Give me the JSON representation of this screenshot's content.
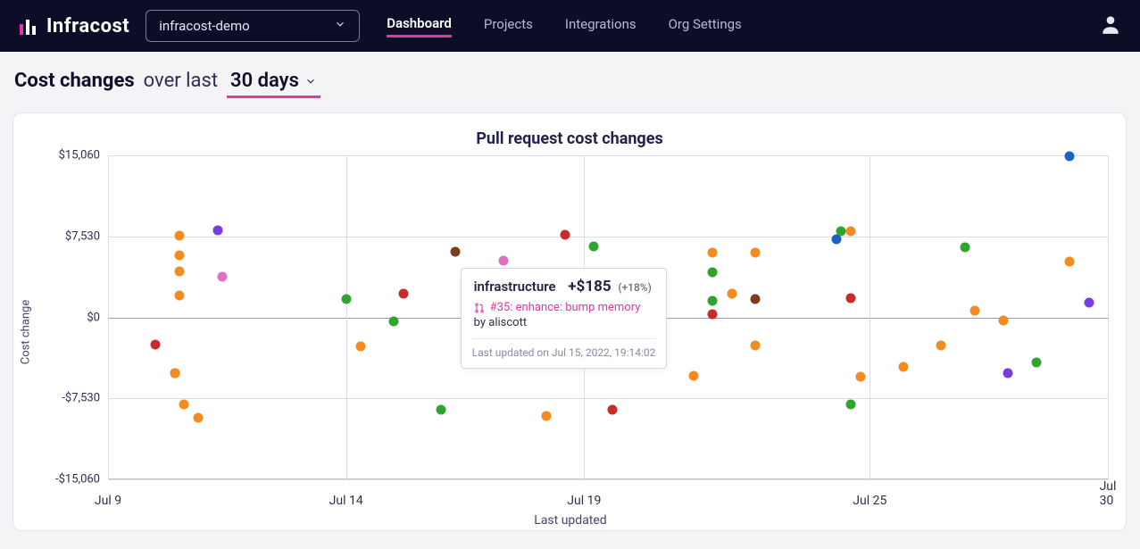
{
  "brand": {
    "name": "Infracost"
  },
  "org_select": {
    "value": "infracost-demo"
  },
  "nav": {
    "items": [
      {
        "label": "Dashboard",
        "active": true
      },
      {
        "label": "Projects",
        "active": false
      },
      {
        "label": "Integrations",
        "active": false
      },
      {
        "label": "Org Settings",
        "active": false
      }
    ]
  },
  "header": {
    "strong": "Cost changes",
    "muted": "over last",
    "range": "30 days"
  },
  "chart_data": {
    "type": "scatter",
    "title": "Pull request cost changes",
    "xlabel": "Last updated",
    "ylabel": "Cost change",
    "ylim": [
      -15060,
      15060
    ],
    "xlim": [
      9,
      30
    ],
    "x_ticks": [
      {
        "x": 9,
        "label": "Jul 9"
      },
      {
        "x": 14,
        "label": "Jul 14"
      },
      {
        "x": 19,
        "label": "Jul 19"
      },
      {
        "x": 25,
        "label": "Jul 25"
      },
      {
        "x": 30,
        "label": "Jul 30"
      }
    ],
    "y_ticks": [
      {
        "y": -15060,
        "label": "-$15,060"
      },
      {
        "y": -7530,
        "label": "-$7,530"
      },
      {
        "y": 0,
        "label": "$0"
      },
      {
        "y": 7530,
        "label": "$7,530"
      },
      {
        "y": 15060,
        "label": "$15,060"
      }
    ],
    "colors": {
      "orange": "#f58a1f",
      "green": "#2fa52f",
      "red": "#c92a2a",
      "purple": "#7a3ce0",
      "pink": "#e06fc4",
      "brown": "#7a3d1d",
      "blue": "#1b61c9"
    },
    "series": [
      {
        "x": 10.0,
        "y": -2500,
        "c": "red"
      },
      {
        "x": 10.4,
        "y": -5200,
        "c": "purple"
      },
      {
        "x": 10.4,
        "y": -5200,
        "c": "orange"
      },
      {
        "x": 10.5,
        "y": 7600,
        "c": "orange"
      },
      {
        "x": 10.5,
        "y": 5800,
        "c": "orange"
      },
      {
        "x": 10.5,
        "y": 4300,
        "c": "orange"
      },
      {
        "x": 10.5,
        "y": 2000,
        "c": "orange"
      },
      {
        "x": 10.6,
        "y": -8100,
        "c": "orange"
      },
      {
        "x": 10.9,
        "y": -9300,
        "c": "orange"
      },
      {
        "x": 11.4,
        "y": 3800,
        "c": "pink"
      },
      {
        "x": 11.3,
        "y": 8100,
        "c": "purple"
      },
      {
        "x": 14.0,
        "y": 1700,
        "c": "green"
      },
      {
        "x": 14.3,
        "y": -2700,
        "c": "orange"
      },
      {
        "x": 15.0,
        "y": -400,
        "c": "green"
      },
      {
        "x": 15.2,
        "y": 2200,
        "c": "red"
      },
      {
        "x": 16.0,
        "y": -8600,
        "c": "green"
      },
      {
        "x": 16.3,
        "y": 6100,
        "c": "brown"
      },
      {
        "x": 17.3,
        "y": 5300,
        "c": "pink"
      },
      {
        "x": 18.2,
        "y": -9200,
        "c": "orange"
      },
      {
        "x": 18.6,
        "y": 7700,
        "c": "red"
      },
      {
        "x": 19.2,
        "y": 6600,
        "c": "green"
      },
      {
        "x": 19.6,
        "y": -8600,
        "c": "red"
      },
      {
        "x": 21.3,
        "y": -5400,
        "c": "orange"
      },
      {
        "x": 21.7,
        "y": 6000,
        "c": "orange"
      },
      {
        "x": 21.7,
        "y": 4200,
        "c": "green"
      },
      {
        "x": 21.7,
        "y": 1500,
        "c": "green"
      },
      {
        "x": 21.7,
        "y": 300,
        "c": "red"
      },
      {
        "x": 22.1,
        "y": 2200,
        "c": "orange"
      },
      {
        "x": 22.6,
        "y": 6000,
        "c": "orange"
      },
      {
        "x": 22.6,
        "y": 1700,
        "c": "brown"
      },
      {
        "x": 22.6,
        "y": -2600,
        "c": "orange"
      },
      {
        "x": 24.3,
        "y": 7300,
        "c": "blue"
      },
      {
        "x": 24.4,
        "y": 8000,
        "c": "green"
      },
      {
        "x": 24.6,
        "y": 8000,
        "c": "orange"
      },
      {
        "x": 24.6,
        "y": 1800,
        "c": "red"
      },
      {
        "x": 24.6,
        "y": -8100,
        "c": "green"
      },
      {
        "x": 24.8,
        "y": -5500,
        "c": "orange"
      },
      {
        "x": 25.7,
        "y": -4600,
        "c": "orange"
      },
      {
        "x": 26.5,
        "y": -2600,
        "c": "orange"
      },
      {
        "x": 27.0,
        "y": 6500,
        "c": "green"
      },
      {
        "x": 27.2,
        "y": 600,
        "c": "orange"
      },
      {
        "x": 27.8,
        "y": -300,
        "c": "orange"
      },
      {
        "x": 27.9,
        "y": -5200,
        "c": "purple"
      },
      {
        "x": 28.5,
        "y": -4200,
        "c": "green"
      },
      {
        "x": 29.2,
        "y": 5200,
        "c": "orange"
      },
      {
        "x": 29.2,
        "y": 15000,
        "c": "blue"
      },
      {
        "x": 29.6,
        "y": 1400,
        "c": "purple"
      }
    ]
  },
  "tooltip": {
    "project": "infrastructure",
    "amount": "+$185",
    "pct": "(+18%)",
    "pr": "#35: enhance: bump memory",
    "author_prefix": "by ",
    "author": "aliscott",
    "updated": "Last updated on Jul 15, 2022, 19:14:02"
  }
}
